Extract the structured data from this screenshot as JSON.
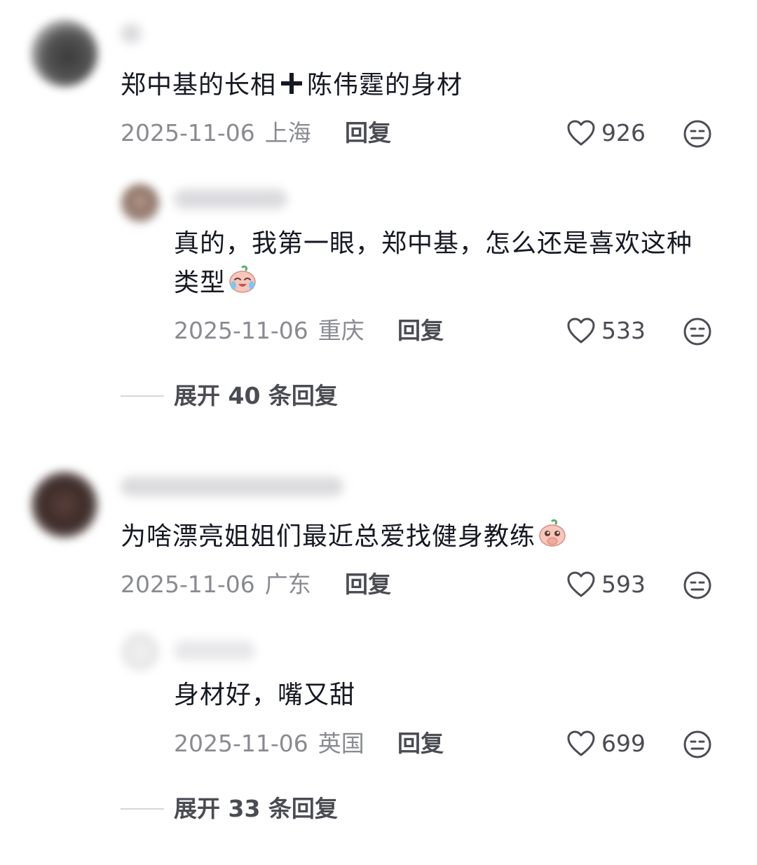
{
  "comments": [
    {
      "text_before": "郑中基的长相",
      "text_after": "陈伟霆的身材",
      "date": "2025-11-06",
      "location": "上海",
      "reply_label": "回复",
      "likes": "926",
      "replies": [
        {
          "text": "真的，我第一眼，郑中基，怎么还是喜欢这种类型",
          "date": "2025-11-06",
          "location": "重庆",
          "reply_label": "回复",
          "likes": "533"
        }
      ],
      "expand_label": "展开 40 条回复"
    },
    {
      "text": "为啥漂亮姐姐们最近总爱找健身教练",
      "date": "2025-11-06",
      "location": "广东",
      "reply_label": "回复",
      "likes": "593",
      "replies": [
        {
          "text": "身材好，嘴又甜",
          "date": "2025-11-06",
          "location": "英国",
          "reply_label": "回复",
          "likes": "699"
        }
      ],
      "expand_label": "展开 33 条回复"
    }
  ],
  "icons": {
    "like": "heart-outline-icon",
    "dislike": "neutral-face-icon",
    "plus": "plus-icon",
    "emoji_crying_laugh": "crying-laugh-emoji-icon",
    "emoji_begging": "begging-emoji-icon"
  },
  "colors": {
    "text": "#161823",
    "meta": "#8a8b91",
    "action": "#4b4c53"
  }
}
